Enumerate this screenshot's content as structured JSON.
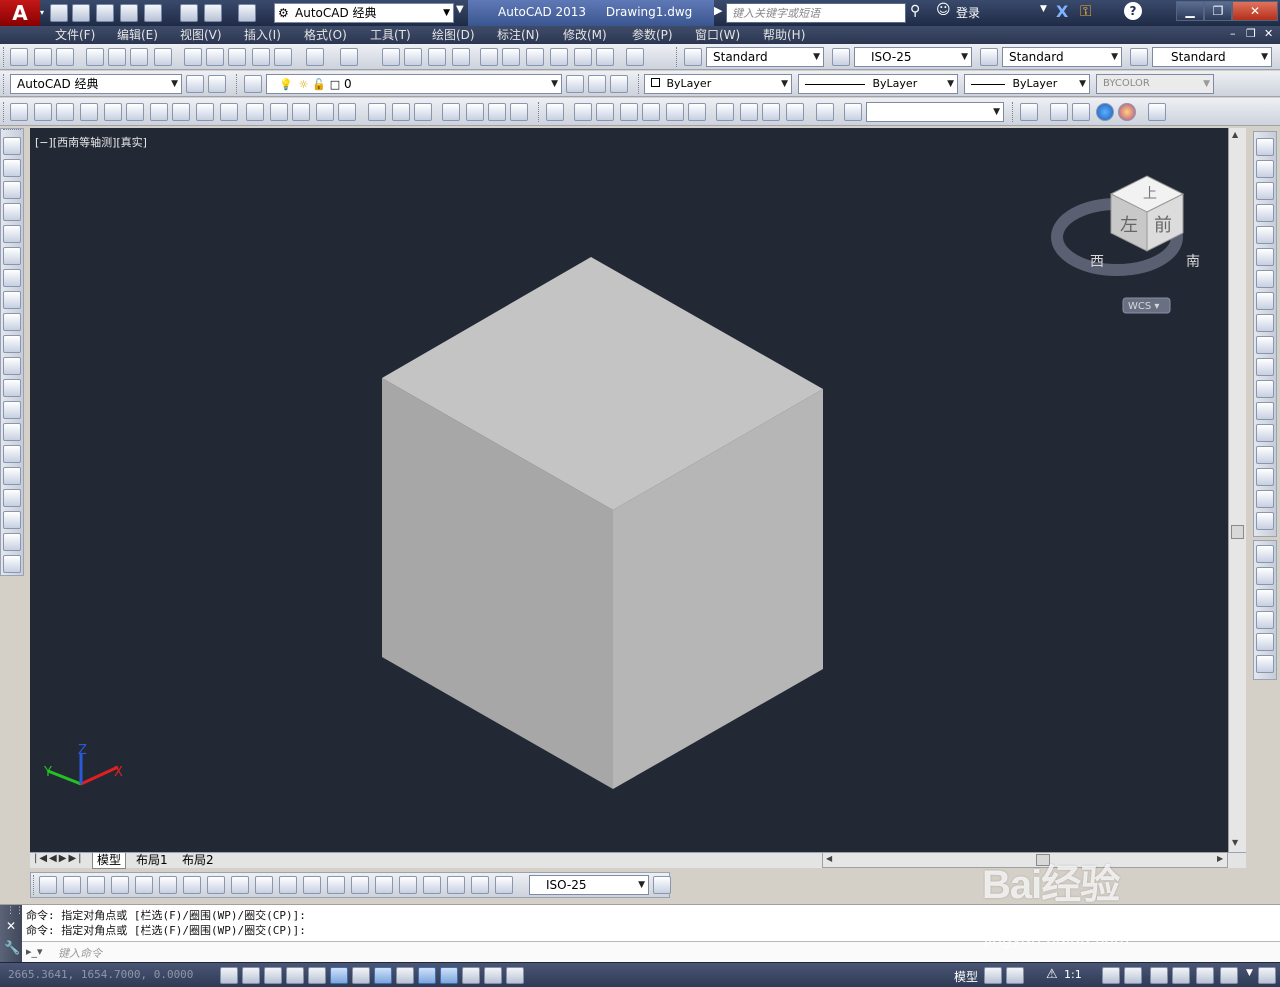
{
  "titlebar": {
    "app_logo": "A",
    "workspace": "AutoCAD 经典",
    "app_name": "AutoCAD 2013",
    "file_name": "Drawing1.dwg",
    "search_placeholder": "键入关键字或短语",
    "login": "登录"
  },
  "menu": [
    "文件(F)",
    "编辑(E)",
    "视图(V)",
    "插入(I)",
    "格式(O)",
    "工具(T)",
    "绘图(D)",
    "标注(N)",
    "修改(M)",
    "参数(P)",
    "窗口(W)",
    "帮助(H)"
  ],
  "styles_toolbar": {
    "text_style": "Standard",
    "dim_style": "ISO-25",
    "table_style": "Standard",
    "multileader_style": "Standard"
  },
  "layers_toolbar": {
    "workspace": "AutoCAD 经典",
    "layer": "0"
  },
  "properties_toolbar": {
    "color": "ByLayer",
    "linetype": "ByLayer",
    "lineweight": "ByLayer",
    "plot_style": "BYCOLOR"
  },
  "viewport": {
    "label": "[−][西南等轴测][真实]",
    "viewcube": {
      "top": "上",
      "left": "左",
      "front": "前",
      "west": "西",
      "south": "南"
    },
    "wcs": "WCS ▾",
    "ucs": {
      "x": "X",
      "y": "Y",
      "z": "Z"
    },
    "colors": {
      "background": "#222834",
      "cube_top": "#c4c4c4",
      "cube_left": "#a7a7a7",
      "cube_right": "#b6b6b6"
    }
  },
  "tabs": [
    "模型",
    "布局1",
    "布局2"
  ],
  "dim_toolbar": {
    "dim_style": "ISO-25"
  },
  "command": {
    "line1": "命令: 指定对角点或 [栏选(F)/圈围(WP)/圈交(CP)]:",
    "line2": "命令: 指定对角点或 [栏选(F)/圈围(WP)/圈交(CP)]:",
    "input_placeholder": "键入命令"
  },
  "status": {
    "coords": "2665.3641, 1654.7000, 0.0000",
    "model": "模型",
    "scale": "1:1"
  },
  "watermark": {
    "brand": "Bai经验",
    "url": "jingyan.baidu.com"
  }
}
